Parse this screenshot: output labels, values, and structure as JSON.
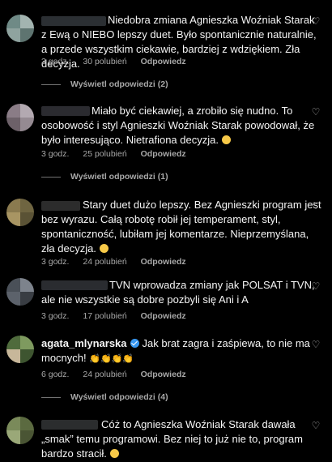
{
  "comments": [
    {
      "text": "Niedobra zmiana Agnieszka Woźniak Starak z Ewą o NIEBO lepszy duet. Było spontanicznie naturalnie, a przede wszystkim ciekawie, bardziej z wdziękiem. Zła decyzja.",
      "time": "3 godz.",
      "likes": "30 polubień",
      "reply": "Odpowiedz",
      "view_replies": "Wyświetl odpowiedzi (2)"
    },
    {
      "text": "Miało być ciekawiej, a zrobiło się nudno. To osobowość i styl Agnieszki Woźniak Starak powodował, że było interesująco. Nietrafiona decyzja.",
      "time": "3 godz.",
      "likes": "25 polubień",
      "reply": "Odpowiedz",
      "view_replies": "Wyświetl odpowiedzi (1)"
    },
    {
      "text": "Stary duet dużo lepszy. Bez Agnieszki program jest bez wyrazu. Całą robotę robił jej temperament, styl, spontaniczność, lubiłam jej komentarze. Nieprzemyślana, zła decyzja.",
      "time": "3 godz.",
      "likes": "24 polubień",
      "reply": "Odpowiedz"
    },
    {
      "text": "TVN wprowadza zmiany jak POLSAT i TVN, ale nie wszystkie są dobre pozbyli się Ani i A",
      "time": "3 godz.",
      "likes": "17 polubień",
      "reply": "Odpowiedz"
    },
    {
      "username": "agata_mlynarska",
      "text": "Jak brat zagra i zaśpiewa, to nie ma mocnych!",
      "time": "6 godz.",
      "likes": "24 polubień",
      "reply": "Odpowiedz",
      "view_replies": "Wyświetl odpowiedzi (4)"
    },
    {
      "text": "Cóż to Agnieszka Woźniak Starak dawała „smak” temu programowi. Bez niej to już nie to, program bardzo stracił."
    }
  ]
}
